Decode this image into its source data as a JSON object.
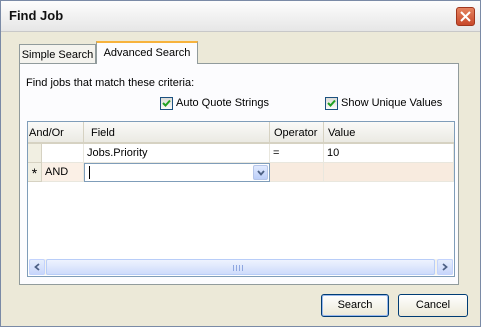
{
  "window": {
    "title": "Find Job"
  },
  "tabs": [
    {
      "label": "Simple Search",
      "active": false
    },
    {
      "label": "Advanced Search",
      "active": true
    }
  ],
  "panel": {
    "criteria_label": "Find jobs that match these criteria:",
    "options": {
      "auto_quote": {
        "label": "Auto Quote Strings",
        "checked": true
      },
      "unique_values": {
        "label": "Show Unique Values",
        "checked": true
      }
    }
  },
  "grid": {
    "columns": [
      "And/Or",
      "Field",
      "Operator",
      "Value"
    ],
    "rows": [
      {
        "and_or": "",
        "field": "Jobs.Priority",
        "operator": "=",
        "value": "10"
      },
      {
        "marker": "*",
        "and_or": "AND",
        "field": "",
        "operator": "",
        "value": ""
      }
    ],
    "scrollbar": {
      "has_horizontal": true
    }
  },
  "buttons": {
    "search": "Search",
    "cancel": "Cancel"
  },
  "colors": {
    "tab_accent": "#f7b33d",
    "close_button": "#c8482a",
    "new_row": "#fbf0e6"
  }
}
